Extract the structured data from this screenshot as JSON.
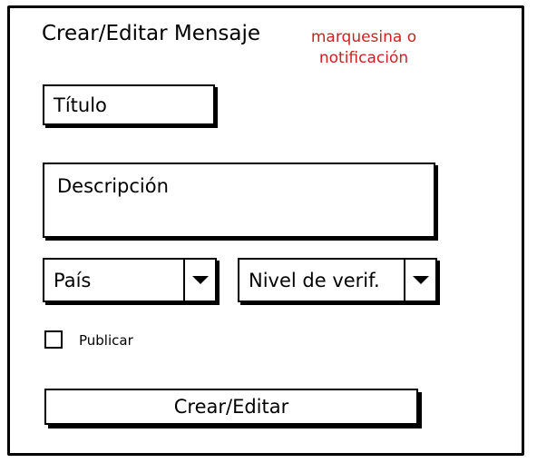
{
  "form": {
    "title": "Crear/Editar Mensaje",
    "note": "marquesina o notificación",
    "title_field": "Título",
    "description_field": "Descripción",
    "country_select": "País",
    "level_select": "Nivel de verif.",
    "publish_label": "Publicar",
    "submit_label": "Crear/Editar"
  },
  "colors": {
    "note": "#cc2222",
    "border": "#000000",
    "background": "#ffffff"
  },
  "icons": {
    "dropdown": "chevron-down-icon"
  }
}
